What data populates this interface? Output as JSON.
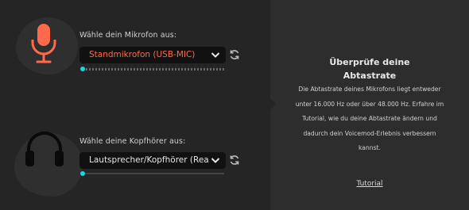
{
  "microphone": {
    "label": "Wähle dein Mikrofon aus:",
    "selected": "Standmikrofon (USB-MIC)"
  },
  "headphones": {
    "label": "Wähle deine Kopfhörer aus:",
    "selected": "Lautsprecher/Kopfhörer (Rea..."
  },
  "info": {
    "title_line1": "Überprüfe deine",
    "title_line2": "Abtastrate",
    "body": "Die Abtastrate deines Mikrofons liegt entweder unter 16.000 Hz oder über 48.000 Hz. Erfahre im Tutorial, wie du deine Abtastrate ändern und dadurch dein Voicemod-Erlebnis verbessern kannst.",
    "link": "Tutorial"
  },
  "colors": {
    "accent": "#ff6a4a",
    "level": "#17d7e5",
    "panel_left": "#252525",
    "panel_right": "#2d2d2d"
  },
  "icons": {
    "mic": "microphone-icon",
    "headphones": "headphones-icon",
    "refresh": "refresh-icon",
    "dropdown": "chevron-down-icon"
  }
}
